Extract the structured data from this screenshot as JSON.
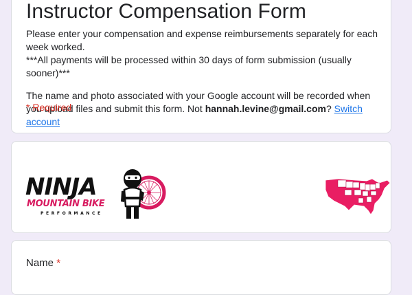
{
  "form": {
    "title": "Instructor Compensation Form",
    "description_line1": "Please enter your compensation and expense reimbursements separately for each week worked.",
    "description_line2": "***All payments will be processed within 30 days of form submission (usually sooner)***",
    "account_notice_prefix": "The name and photo associated with your Google account will be recorded when you upload files and submit this form. Not ",
    "account_email": "hannah.levine@gmail.com",
    "account_notice_suffix": "?",
    "switch_account_label": "Switch account",
    "required_note": "* Required"
  },
  "banner": {
    "logo_word": "NINJA",
    "logo_subtitle": "MOUNTAIN BIKE",
    "logo_tagline": "PERFORMANCE",
    "icons": [
      "ninja-logo-icon",
      "bike-wheel-icon",
      "us-map-icon"
    ],
    "colors": {
      "brand_pink": "#d81b60",
      "ink": "#111111"
    }
  },
  "questions": [
    {
      "label": "Name",
      "required_mark": "*"
    }
  ],
  "theme": {
    "background": "#f0ebf8",
    "link": "#1a73e8",
    "required": "#d93025"
  }
}
